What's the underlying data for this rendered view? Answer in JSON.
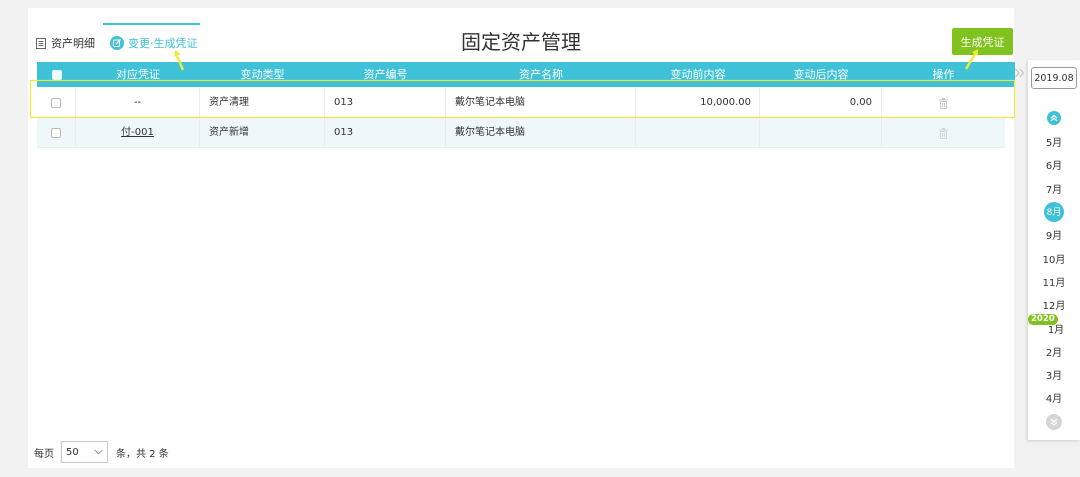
{
  "tabs": [
    {
      "label": "资产明细",
      "icon": "document-icon",
      "active": false
    },
    {
      "label": "变更·生成凭证",
      "icon": "edit-circle-icon",
      "active": true
    }
  ],
  "page_title": "固定资产管理",
  "toolbar": {
    "generate_voucher_label": "生成凭证"
  },
  "table": {
    "columns": [
      "对应凭证",
      "变动类型",
      "资产编号",
      "资产名称",
      "变动前内容",
      "变动后内容",
      "操作"
    ],
    "rows": [
      {
        "checked": false,
        "voucher": "--",
        "change_type": "资产清理",
        "asset_code": "013",
        "asset_name": "戴尔笔记本电脑",
        "before_value": "10,000.00",
        "after_value": "0.00",
        "action_icon": "trash-icon"
      },
      {
        "checked": false,
        "voucher": "付-001",
        "change_type": "资产新增",
        "asset_code": "013",
        "asset_name": "戴尔笔记本电脑",
        "before_value": "",
        "after_value": "",
        "action_icon": "trash-icon"
      }
    ]
  },
  "pagination": {
    "per_page_label": "每页",
    "page_size": "50",
    "select_icon": "chevron-down-icon",
    "summary": "条，共 2 条"
  },
  "period_nav": {
    "expand_icon": "double-chevron-right-icon",
    "current_period": "2019.08",
    "scroll_up_icon": "chevron-up-circle-icon",
    "scroll_down_icon": "chevron-down-circle-icon",
    "months": [
      {
        "label": "5月"
      },
      {
        "label": "6月"
      },
      {
        "label": "7月"
      },
      {
        "label": "8月",
        "active": true
      },
      {
        "label": "9月"
      },
      {
        "label": "10月"
      },
      {
        "label": "11月"
      },
      {
        "label": "12月"
      },
      {
        "label": "1月",
        "year_badge": "2020"
      },
      {
        "label": "2月"
      },
      {
        "label": "3月"
      },
      {
        "label": "4月"
      }
    ]
  },
  "colors": {
    "header_bg": "#3fc1d8",
    "accent_green": "#80c21e",
    "highlight_annotation": "#eeea3c"
  }
}
